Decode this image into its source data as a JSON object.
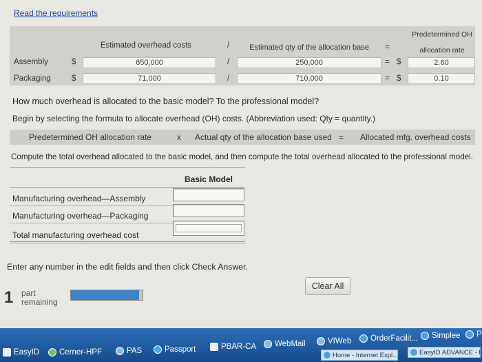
{
  "header": {
    "read_requirements": "Read the requirements"
  },
  "table": {
    "predetermined_header_line1": "Predetermined OH",
    "predetermined_header_line2": "allocation rate",
    "col_estimated_overhead": "Estimated overhead costs",
    "divide_symbol": "/",
    "col_estimated_qty": "Estimated qty of the allocation base",
    "equals_symbol": "=",
    "currency": "$",
    "rows": [
      {
        "label": "Assembly",
        "overhead": "650,000",
        "qty": "250,000",
        "rate": "2.60"
      },
      {
        "label": "Packaging",
        "overhead": "71,000",
        "qty": "710,000",
        "rate": "0.10"
      }
    ]
  },
  "question": "How much overhead is allocated to the basic model? To the professional model?",
  "instruction": "Begin by selecting the formula to allocate overhead (OH) costs. (Abbreviation used: Qty = quantity.)",
  "formula": {
    "term1": "Predetermined OH allocation rate",
    "op1": "x",
    "term2": "Actual qty of the allocation base used",
    "op2": "=",
    "result": "Allocated mfg. overhead costs"
  },
  "compute_instruction": "Compute the total overhead allocated to the basic model, and then compute the total overhead allocated to the professional model.",
  "basic_model": {
    "header": "Basic Model",
    "rows": [
      {
        "label": "Manufacturing overhead—Assembly",
        "value": ""
      },
      {
        "label": "Manufacturing overhead—Packaging",
        "value": ""
      },
      {
        "label": "Total manufacturing overhead cost",
        "value": ""
      }
    ]
  },
  "footer": {
    "enter_instruction": "Enter any number in the edit fields and then click Check Answer.",
    "parts_count": "1",
    "parts_line1": "part",
    "parts_line2": "remaining",
    "progress": 0.95,
    "clear_all": "Clear All"
  },
  "taskbar": {
    "items": [
      {
        "label": "EasyID"
      },
      {
        "label": "Cerner-HPF"
      },
      {
        "label": "PAS"
      },
      {
        "label": "Passport"
      },
      {
        "label": "PBAR-CA"
      },
      {
        "label": "WebMail"
      },
      {
        "label": "VIWeb"
      },
      {
        "label": "OrderFacilit..."
      },
      {
        "label": "Simplee"
      },
      {
        "label": "P"
      }
    ],
    "windows": [
      {
        "label": "Home - Internet Expl..."
      },
      {
        "label": "EasyID ADVANCE - H..."
      }
    ]
  }
}
